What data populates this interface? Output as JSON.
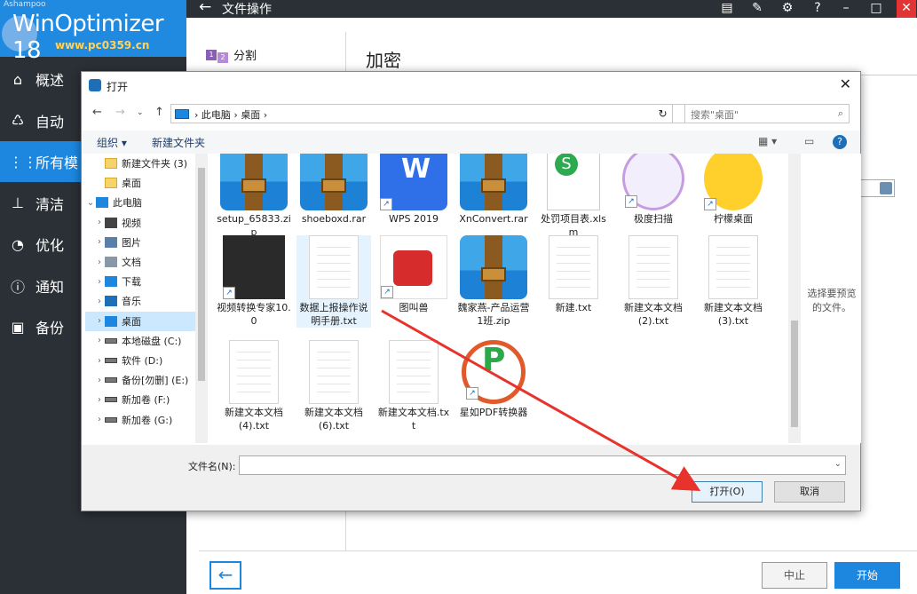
{
  "app": {
    "brand": "Ashampoo",
    "product": "WinOptimizer 18",
    "watermark": "www.pc0359.cn",
    "page_title": "文件操作",
    "nav": [
      {
        "label": "概述",
        "icon": "home-icon"
      },
      {
        "label": "自动",
        "icon": "automation-icon"
      },
      {
        "label": "所有模",
        "icon": "grid-icon",
        "active": true
      },
      {
        "label": "清洁",
        "icon": "broom-icon"
      },
      {
        "label": "优化",
        "icon": "gauge-icon"
      },
      {
        "label": "通知",
        "icon": "info-icon"
      },
      {
        "label": "备份",
        "icon": "backup-icon"
      }
    ],
    "left_panel_item": "分割",
    "main_title": "加密",
    "stop_label": "中止",
    "start_label": "开始",
    "accent_color": "#1d87df"
  },
  "dialog": {
    "title": "打开",
    "breadcrumb": [
      "此电脑",
      "桌面"
    ],
    "search_placeholder": "搜索\"桌面\"",
    "toolbar": {
      "organize": "组织 ▾",
      "new_folder": "新建文件夹"
    },
    "tree": [
      {
        "label": "新建文件夹 (3)",
        "type": "folder",
        "indent": 1
      },
      {
        "label": "桌面",
        "type": "folder",
        "indent": 1
      },
      {
        "label": "此电脑",
        "type": "pc",
        "indent": 0,
        "expanded": true
      },
      {
        "label": "视频",
        "type": "video",
        "indent": 1
      },
      {
        "label": "图片",
        "type": "pictures",
        "indent": 1
      },
      {
        "label": "文档",
        "type": "docs",
        "indent": 1
      },
      {
        "label": "下载",
        "type": "download",
        "indent": 1
      },
      {
        "label": "音乐",
        "type": "music",
        "indent": 1
      },
      {
        "label": "桌面",
        "type": "desktop",
        "indent": 1,
        "selected": true
      },
      {
        "label": "本地磁盘 (C:)",
        "type": "drive",
        "indent": 1
      },
      {
        "label": "软件 (D:)",
        "type": "drive",
        "indent": 1
      },
      {
        "label": "备份[勿删] (E:)",
        "type": "drive",
        "indent": 1
      },
      {
        "label": "新加卷 (F:)",
        "type": "drive",
        "indent": 1
      },
      {
        "label": "新加卷 (G:)",
        "type": "drive",
        "indent": 1
      }
    ],
    "files": [
      {
        "name": "setup_65833.zip",
        "kind": "archive"
      },
      {
        "name": "shoeboxd.rar",
        "kind": "archive"
      },
      {
        "name": "WPS 2019",
        "kind": "wps",
        "shortcut": true
      },
      {
        "name": "XnConvert.rar",
        "kind": "archive"
      },
      {
        "name": "处罚项目表.xlsm",
        "kind": "xls"
      },
      {
        "name": "极度扫描",
        "kind": "wolf",
        "shortcut": true
      },
      {
        "name": "柠檬桌面",
        "kind": "lemon",
        "shortcut": true
      },
      {
        "name": "视频转换专家10.0",
        "kind": "video",
        "shortcut": true
      },
      {
        "name": "数据上报操作说明手册.txt",
        "kind": "doc",
        "selected": true
      },
      {
        "name": "图叫兽",
        "kind": "tjs",
        "shortcut": true
      },
      {
        "name": "魏家燕-产品运营1班.zip",
        "kind": "archive"
      },
      {
        "name": "新建.txt",
        "kind": "doc"
      },
      {
        "name": "新建文本文档(2).txt",
        "kind": "doc"
      },
      {
        "name": "新建文本文档(3).txt",
        "kind": "doc"
      },
      {
        "name": "新建文本文档(4).txt",
        "kind": "doc"
      },
      {
        "name": "新建文本文档(6).txt",
        "kind": "doc"
      },
      {
        "name": "新建文本文档.txt",
        "kind": "doc"
      },
      {
        "name": "星如PDF转换器",
        "kind": "pdf",
        "shortcut": true
      }
    ],
    "preview_text": "选择要预览的文件。",
    "filename_label": "文件名(N):",
    "filename_value": "",
    "open_label": "打开(O)",
    "cancel_label": "取消"
  }
}
